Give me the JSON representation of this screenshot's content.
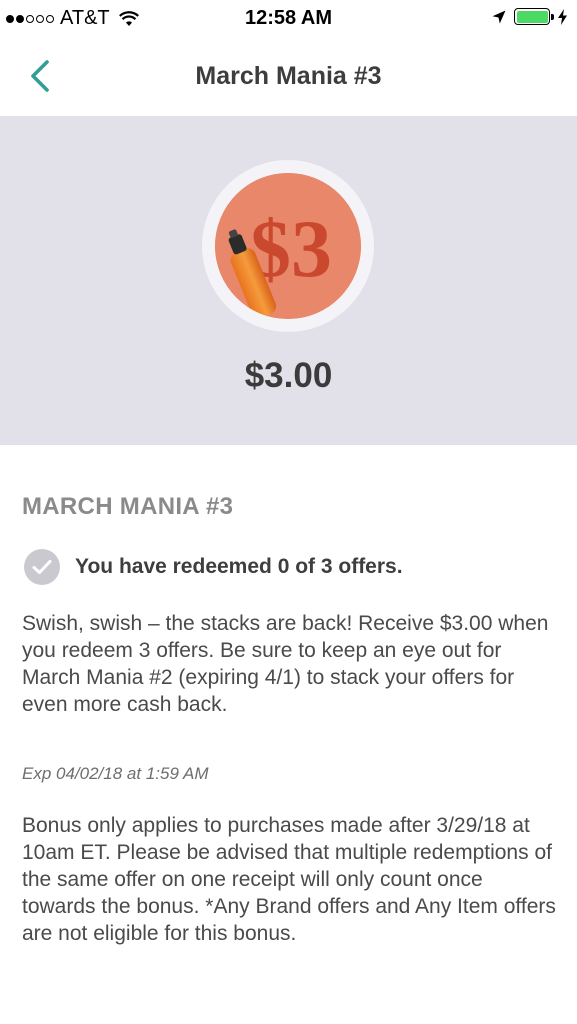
{
  "status_bar": {
    "carrier": "AT&T",
    "time": "12:58 AM",
    "signal_bars_filled": 2,
    "signal_bars_total": 5,
    "battery_level": 1.0,
    "icons": [
      "wifi-icon",
      "location-arrow-icon",
      "battery-icon",
      "charging-bolt-icon"
    ]
  },
  "nav": {
    "title": "March Mania #3",
    "back_icon": "chevron-left-icon"
  },
  "hero": {
    "image_label": "$3",
    "amount": "$3.00"
  },
  "offer": {
    "title": "MARCH MANIA #3",
    "progress_text": "You have redeemed 0 of 3 offers.",
    "description": "Swish, swish – the stacks are back! Receive $3.00 when you redeem 3 offers. Be sure to keep an eye out for March Mania #2 (expiring 4/1) to stack your offers for even more cash back.",
    "expiry": "Exp 04/02/18 at 1:59 AM",
    "terms": "Bonus only applies to purchases made after 3/29/18 at 10am ET. Please be advised that multiple redemptions of the same offer on one receipt will only count once towards the bonus. *Any Brand offers and Any Item offers are not eligible for this bonus."
  },
  "colors": {
    "accent": "#2f9e93",
    "hero_bg": "#e2e1ea",
    "offer_orange": "#e9876b",
    "battery_green": "#4cd964"
  }
}
